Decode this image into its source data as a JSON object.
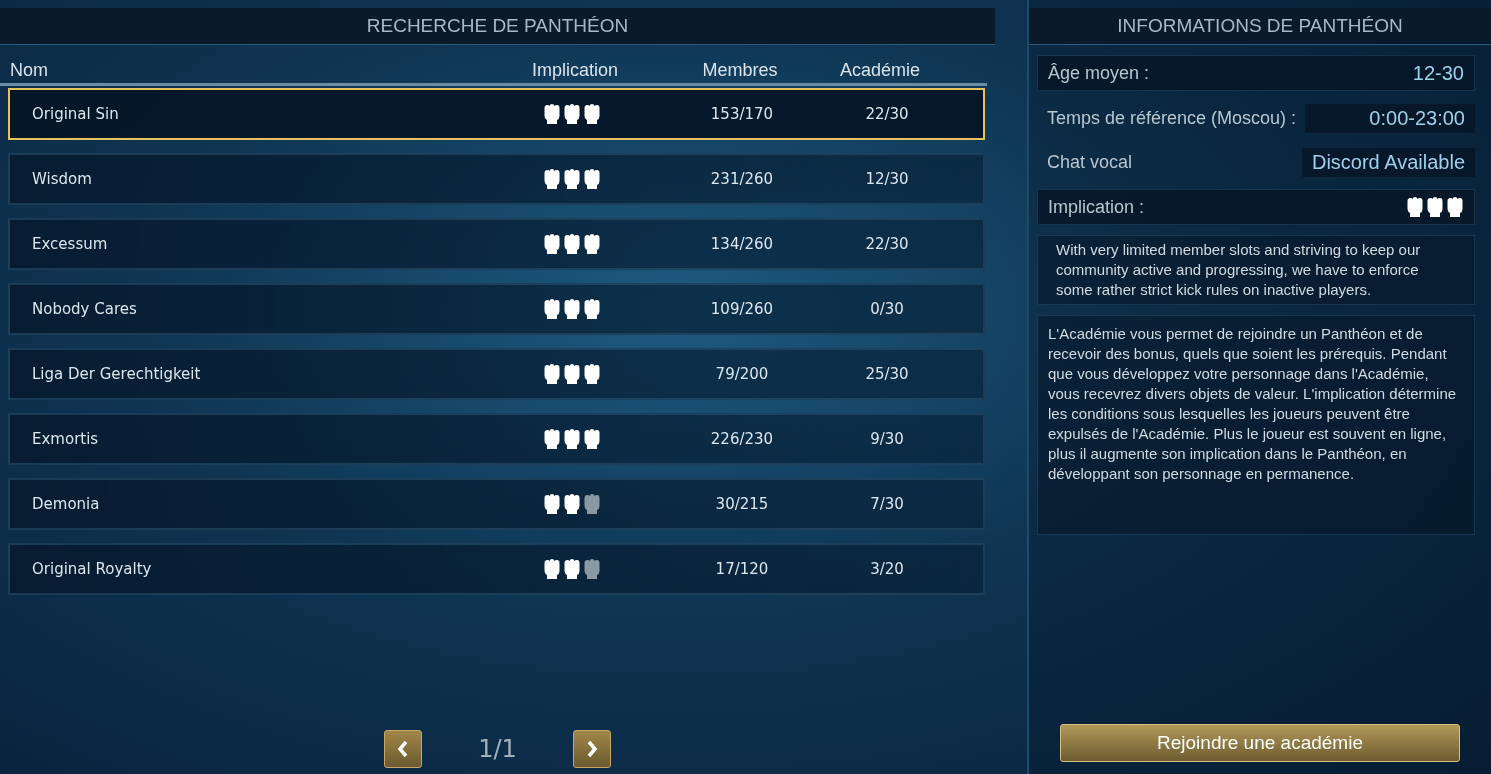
{
  "search_panel": {
    "title": "RECHERCHE DE PANTHÉON",
    "columns": [
      "Nom",
      "Implication",
      "Membres",
      "Académie"
    ],
    "rows": [
      {
        "name": "Original Sin",
        "stars": 3,
        "members": "153/170",
        "academy": "22/30",
        "selected": true
      },
      {
        "name": "Wisdom",
        "stars": 3,
        "members": "231/260",
        "academy": "12/30",
        "selected": false
      },
      {
        "name": "Excessum",
        "stars": 3,
        "members": "134/260",
        "academy": "22/30",
        "selected": false
      },
      {
        "name": "Nobody Cares",
        "stars": 3,
        "members": "109/260",
        "academy": "0/30",
        "selected": false
      },
      {
        "name": "Liga Der Gerechtigkeit",
        "stars": 3,
        "members": "79/200",
        "academy": "25/30",
        "selected": false
      },
      {
        "name": "Exmortis",
        "stars": 3,
        "members": "226/230",
        "academy": "9/30",
        "selected": false
      },
      {
        "name": "Demonia",
        "stars": 2,
        "members": "30/215",
        "academy": "7/30",
        "selected": false
      },
      {
        "name": "Original Royalty",
        "stars": 2,
        "members": "17/120",
        "academy": "3/20",
        "selected": false
      }
    ],
    "pager": {
      "label": "1/1"
    }
  },
  "info_panel": {
    "title": "INFORMATIONS DE PANTHÉON",
    "average_age": {
      "label": "Âge moyen :",
      "value": "12-30"
    },
    "reference_time": {
      "label": "Temps de référence (Moscou) :",
      "value": "0:00-23:00"
    },
    "voice_chat": {
      "label": "Chat vocal",
      "value": "Discord Available"
    },
    "implication": {
      "label": "Implication :",
      "stars": 3
    },
    "description": "With very limited member slots and striving to keep our community active and progressing, we have to enforce some rather strict kick rules on inactive players.",
    "academy_info": "L'Académie vous permet de rejoindre un Panthéon et de recevoir des bonus, quels que soient les prérequis. Pendant que vous développez votre personnage dans l'Académie, vous recevrez divers objets de valeur. L'implication détermine les conditions sous lesquelles les joueurs peuvent être expulsés de l'Académie.  Plus le joueur est souvent en ligne, plus il augmente son implication dans le Panthéon, en développant son personnage en permanence.",
    "join_button": "Rejoindre une académie"
  }
}
